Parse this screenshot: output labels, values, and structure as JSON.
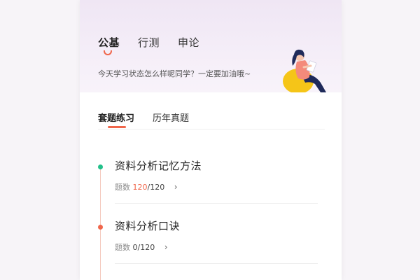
{
  "top_tabs": [
    {
      "label": "公基",
      "active": true
    },
    {
      "label": "行测",
      "active": false
    },
    {
      "label": "申论",
      "active": false
    }
  ],
  "greeting": "今天学习状态怎么样呢同学？一定要加油哦~",
  "sub_tabs": [
    {
      "label": "套题练习",
      "active": true
    },
    {
      "label": "历年真题",
      "active": false
    }
  ],
  "items": [
    {
      "title": "资料分析记忆方法",
      "meta_label": "题数",
      "done": "120",
      "sep_total": "/120",
      "dot_color": "#22c08a"
    },
    {
      "title": "资料分析口诀",
      "meta_label": "题数",
      "done": "0",
      "sep_total": "/120",
      "dot_color": "#f0664b"
    }
  ],
  "colors": {
    "accent": "#f0664b",
    "green": "#22c08a"
  },
  "icons": {
    "chevron": "chevron-right-icon"
  }
}
